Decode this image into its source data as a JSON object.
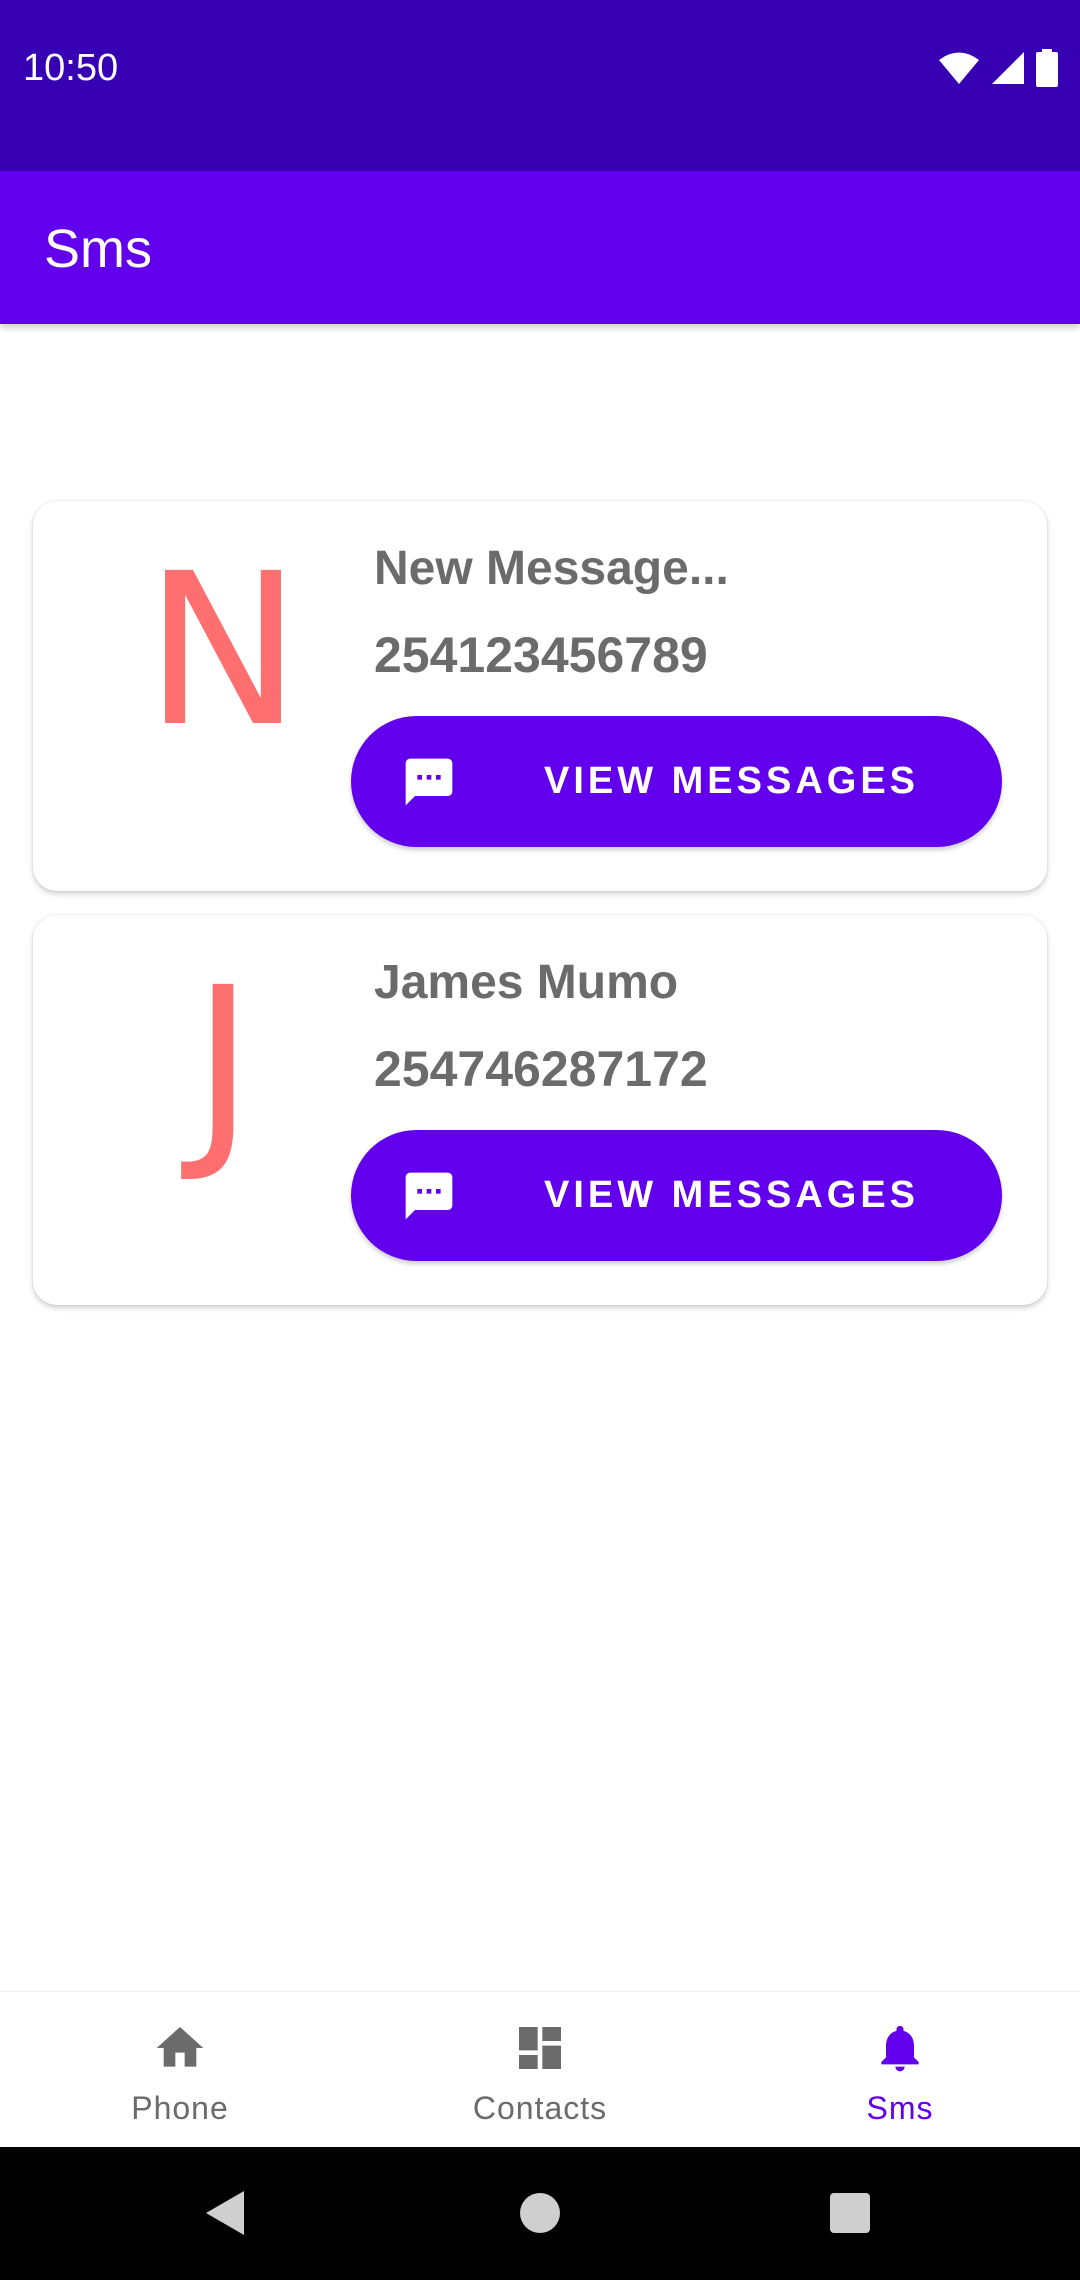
{
  "status_bar": {
    "time": "10:50",
    "icons": [
      "wifi-icon",
      "signal-icon",
      "battery-icon"
    ],
    "background": "#3700b3"
  },
  "app_bar": {
    "title": "Sms",
    "background": "#6200ee"
  },
  "conversations": [
    {
      "initial": "N",
      "name": "New Message...",
      "phone": "254123456789",
      "button_label": "VIEW MESSAGES",
      "button_icon": "message-icon"
    },
    {
      "initial": "J",
      "name": "James Mumo",
      "phone": "254746287172",
      "button_label": "VIEW MESSAGES",
      "button_icon": "message-icon"
    }
  ],
  "bottom_nav": {
    "items": [
      {
        "label": "Phone",
        "icon": "home-icon",
        "selected": false
      },
      {
        "label": "Contacts",
        "icon": "dashboard-icon",
        "selected": false
      },
      {
        "label": "Sms",
        "icon": "bell-icon",
        "selected": true
      }
    ],
    "active_color": "#6200ee",
    "inactive_color": "#6b6b6b"
  },
  "system_nav": {
    "buttons": [
      "back-icon",
      "home-circle-icon",
      "recents-icon"
    ]
  },
  "colors": {
    "primary": "#6200ee",
    "primary_dark": "#3700b3",
    "avatar_letter": "#ff6f6f",
    "text_secondary": "#6b6b6b"
  }
}
